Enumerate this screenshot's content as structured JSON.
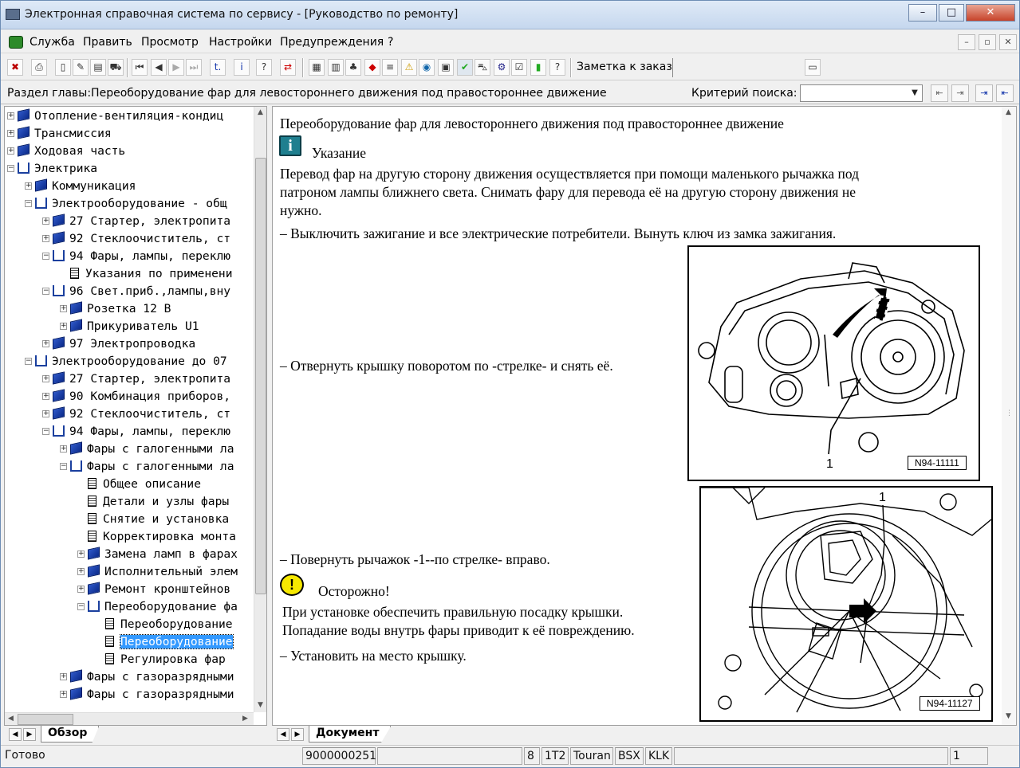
{
  "window": {
    "title": "Электронная справочная система по сервису - [Руководство по ремонту]"
  },
  "menu": [
    "Служба",
    "Править",
    "Просмотр",
    "Настройки",
    "Предупреждения",
    "?"
  ],
  "toolbar": {
    "note_label": "Заметка к заказу:"
  },
  "infobar": {
    "chapter": "Раздел главы:Переоборудование фар для левостороннего движения под правостороннее движение",
    "criteria_label": "Критерий поиска:",
    "criteria_value": ""
  },
  "tree": [
    {
      "label": "Отопление-вентиляция-кондиц",
      "level": 0,
      "icon": "book",
      "exp": "+"
    },
    {
      "label": "Трансмиссия",
      "level": 0,
      "icon": "book",
      "exp": "+"
    },
    {
      "label": "Ходовая часть",
      "level": 0,
      "icon": "book",
      "exp": "+"
    },
    {
      "label": "Электрика",
      "level": 0,
      "icon": "open",
      "exp": "-"
    },
    {
      "label": "Коммуникация",
      "level": 1,
      "icon": "book",
      "exp": "+"
    },
    {
      "label": "Электрооборудование - общ",
      "level": 1,
      "icon": "open",
      "exp": "-"
    },
    {
      "label": "27 Стартер, электропита",
      "level": 2,
      "icon": "book",
      "exp": "+"
    },
    {
      "label": "92 Стеклоочиститель, ст",
      "level": 2,
      "icon": "book",
      "exp": "+"
    },
    {
      "label": "94 Фары, лампы, переклю",
      "level": 2,
      "icon": "open",
      "exp": "-"
    },
    {
      "label": "Указания по применени",
      "level": 3,
      "icon": "page",
      "exp": ""
    },
    {
      "label": "96 Свет.приб.,лампы,вну",
      "level": 2,
      "icon": "open",
      "exp": "-"
    },
    {
      "label": "Розетка 12 В",
      "level": 3,
      "icon": "book",
      "exp": "+"
    },
    {
      "label": "Прикуриватель U1",
      "level": 3,
      "icon": "book",
      "exp": "+"
    },
    {
      "label": "97 Электропроводка",
      "level": 2,
      "icon": "book",
      "exp": "+"
    },
    {
      "label": "Электрооборудование до 07",
      "level": 1,
      "icon": "open",
      "exp": "-"
    },
    {
      "label": "27 Стартер, электропита",
      "level": 2,
      "icon": "book",
      "exp": "+"
    },
    {
      "label": "90 Комбинация приборов,",
      "level": 2,
      "icon": "book",
      "exp": "+"
    },
    {
      "label": "92 Стеклоочиститель, ст",
      "level": 2,
      "icon": "book",
      "exp": "+"
    },
    {
      "label": "94 Фары, лампы, переклю",
      "level": 2,
      "icon": "open",
      "exp": "-"
    },
    {
      "label": "Фары с галогенными ла",
      "level": 3,
      "icon": "book",
      "exp": "+"
    },
    {
      "label": "Фары с галогенными ла",
      "level": 3,
      "icon": "open",
      "exp": "-"
    },
    {
      "label": "Общее описание",
      "level": 4,
      "icon": "page",
      "exp": ""
    },
    {
      "label": "Детали и узлы фары",
      "level": 4,
      "icon": "page",
      "exp": ""
    },
    {
      "label": "Снятие и установка",
      "level": 4,
      "icon": "page",
      "exp": ""
    },
    {
      "label": "Корректировка монта",
      "level": 4,
      "icon": "page",
      "exp": ""
    },
    {
      "label": "Замена ламп в фарах",
      "level": 4,
      "icon": "book",
      "exp": "+"
    },
    {
      "label": "Исполнительный элем",
      "level": 4,
      "icon": "book",
      "exp": "+"
    },
    {
      "label": "Ремонт кронштейнов",
      "level": 4,
      "icon": "book",
      "exp": "+"
    },
    {
      "label": "Переоборудование фа",
      "level": 4,
      "icon": "open",
      "exp": "-"
    },
    {
      "label": "Переоборудование",
      "level": 5,
      "icon": "page",
      "exp": ""
    },
    {
      "label": "Переоборудование",
      "level": 5,
      "icon": "page",
      "exp": "",
      "selected": true
    },
    {
      "label": "Регулировка фар",
      "level": 5,
      "icon": "page",
      "exp": ""
    },
    {
      "label": "Фары с газоразрядными",
      "level": 3,
      "icon": "book",
      "exp": "+"
    },
    {
      "label": "Фары с газоразрядными",
      "level": 3,
      "icon": "book",
      "exp": "+"
    }
  ],
  "tabs": {
    "left": "Обзор",
    "right": "Документ"
  },
  "doc": {
    "heading": "Переоборудование фар для левостороннего движения под правостороннее движение",
    "note_title": "Указание",
    "note_lines": [
      "Перевод фар на другую сторону движения осуществляется при помощи маленького рычажка под",
      "патроном лампы ближнего света. Снимать фару для перевода её на другую сторону движения не",
      "нужно."
    ],
    "step1": "– Выключить зажигание и все электрические потребители. Вынуть ключ из замка зажигания.",
    "step2": "– Отвернуть крышку поворотом по -стрелке- и снять её.",
    "step3": "– Повернуть рычажок -1--по стрелке- вправо.",
    "caution_title": "Осторожно!",
    "caution_lines": [
      "При установке обеспечить правильную посадку крышки.",
      "Попадание воды внутрь фары приводит к её повреждению."
    ],
    "step4": "– Установить на место крышку.",
    "fig1": {
      "label": "N94-11111",
      "callout": "1"
    },
    "fig2": {
      "label": "N94-11127",
      "callout": "1"
    }
  },
  "status": {
    "ready": "Готово",
    "code": "9000000251",
    "c1": "8",
    "c2": "1T2",
    "model": "Touran",
    "engine": "BSX",
    "gear": "KLK",
    "page": "1"
  }
}
